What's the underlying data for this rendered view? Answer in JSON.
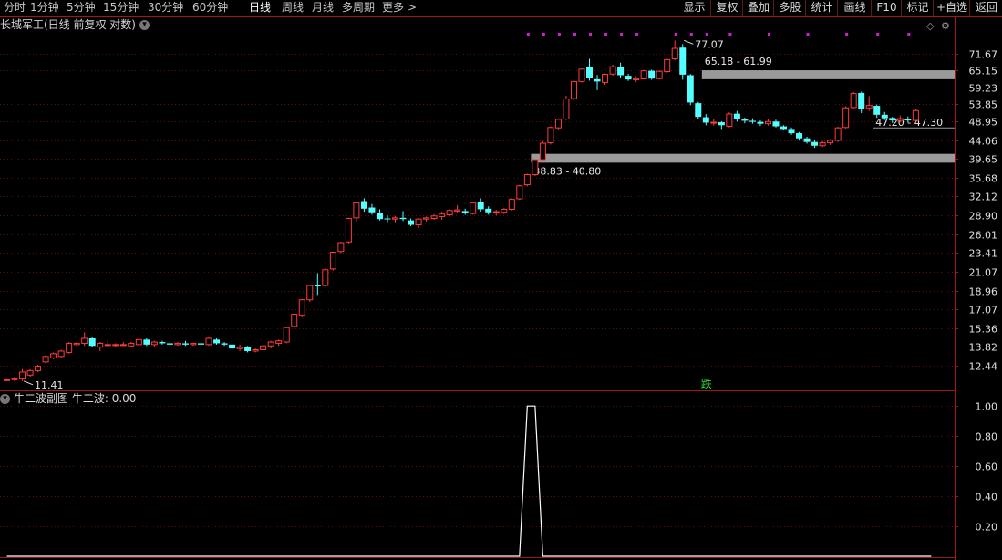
{
  "toolbar": {
    "periods": [
      "分时",
      "1分钟",
      "5分钟",
      "15分钟",
      "30分钟",
      "60分钟",
      "日线",
      "周线",
      "月线",
      "多周期",
      "更多"
    ],
    "more_arrow": ">",
    "active_period": "日线",
    "right_buttons": [
      "显示",
      "复权",
      "叠加",
      "多股",
      "统计",
      "画线",
      "F10",
      "标记",
      "+自选",
      "返回"
    ]
  },
  "main_chart": {
    "title": "长城军工(日线 前复权 对数)",
    "y_ticks": [
      "71.67",
      "65.15",
      "59.23",
      "53.85",
      "48.95",
      "44.06",
      "39.65",
      "35.68",
      "32.12",
      "28.90",
      "26.01",
      "23.41",
      "21.07",
      "18.96",
      "17.07",
      "15.36",
      "13.82",
      "12.44"
    ],
    "low_label": "11.41",
    "high_label": "77.07",
    "zones": [
      {
        "label": "65.18 - 61.99",
        "low": 61.99,
        "high": 65.18
      },
      {
        "label": "38.83 - 40.80",
        "low": 38.83,
        "high": 40.8
      },
      {
        "label": "47.20 - 47.30",
        "low": 47.2,
        "high": 47.3
      }
    ],
    "signal_label": "跌",
    "colors": {
      "up": "#ff3b3b",
      "down": "#54ffff",
      "grid": "#5a1010",
      "axis": "#a01818",
      "marker": "#d020d0",
      "zone": "#9a9a9a"
    }
  },
  "indicator": {
    "title": "牛二波副图",
    "value_label": "牛二波: 0.00",
    "y_ticks": [
      "1.00",
      "0.80",
      "0.60",
      "0.40",
      "0.20"
    ]
  },
  "chart_data": {
    "type": "candlestick",
    "scale": "log",
    "series_name": "长城军工",
    "ylim": [
      11.0,
      80.0
    ],
    "candles": [
      [
        11.5,
        11.6,
        11.4,
        11.5
      ],
      [
        11.5,
        11.7,
        11.4,
        11.6
      ],
      [
        11.6,
        12.2,
        11.41,
        12.0
      ],
      [
        11.8,
        12.2,
        11.7,
        12.1
      ],
      [
        12.1,
        12.5,
        12.0,
        12.4
      ],
      [
        12.7,
        13.2,
        12.6,
        13.1
      ],
      [
        13.0,
        13.4,
        12.9,
        13.3
      ],
      [
        13.1,
        13.6,
        13.0,
        13.5
      ],
      [
        13.4,
        14.2,
        13.3,
        14.1
      ],
      [
        14.0,
        14.2,
        13.9,
        14.1
      ],
      [
        14.1,
        15.0,
        13.9,
        14.5
      ],
      [
        14.5,
        14.6,
        13.8,
        13.9
      ],
      [
        13.8,
        14.2,
        13.5,
        14.1
      ],
      [
        14.0,
        14.3,
        13.8,
        14.0
      ],
      [
        14.0,
        14.1,
        13.8,
        14.0
      ],
      [
        14.0,
        14.2,
        13.9,
        14.0
      ],
      [
        13.9,
        14.2,
        13.8,
        14.1
      ],
      [
        14.0,
        14.5,
        13.9,
        14.4
      ],
      [
        14.4,
        14.5,
        13.9,
        14.0
      ],
      [
        14.0,
        14.3,
        13.8,
        14.2
      ],
      [
        14.2,
        14.3,
        14.0,
        14.1
      ],
      [
        14.1,
        14.2,
        13.9,
        14.0
      ],
      [
        14.0,
        14.2,
        13.9,
        14.1
      ],
      [
        14.1,
        14.3,
        13.9,
        14.0
      ],
      [
        14.0,
        14.1,
        13.9,
        14.1
      ],
      [
        14.1,
        14.2,
        13.9,
        14.0
      ],
      [
        14.0,
        14.6,
        13.9,
        14.5
      ],
      [
        14.4,
        14.5,
        14.0,
        14.1
      ],
      [
        14.1,
        14.2,
        13.9,
        14.0
      ],
      [
        14.0,
        14.1,
        13.6,
        13.7
      ],
      [
        13.7,
        14.0,
        13.5,
        13.8
      ],
      [
        13.8,
        13.9,
        13.4,
        13.5
      ],
      [
        13.5,
        13.7,
        13.4,
        13.6
      ],
      [
        13.6,
        14.0,
        13.5,
        13.9
      ],
      [
        13.9,
        14.3,
        13.7,
        14.2
      ],
      [
        14.1,
        14.4,
        13.9,
        14.3
      ],
      [
        14.2,
        15.5,
        14.1,
        15.4
      ],
      [
        15.5,
        16.7,
        15.3,
        16.6
      ],
      [
        16.5,
        18.1,
        16.3,
        18.0
      ],
      [
        18.0,
        19.6,
        17.8,
        19.5
      ],
      [
        19.5,
        20.9,
        18.5,
        19.4
      ],
      [
        19.5,
        21.5,
        19.3,
        21.3
      ],
      [
        21.4,
        23.6,
        21.2,
        23.5
      ],
      [
        23.6,
        24.9,
        23.4,
        24.8
      ],
      [
        24.9,
        28.5,
        24.7,
        28.4
      ],
      [
        28.5,
        31.2,
        27.9,
        31.0
      ],
      [
        31.3,
        31.8,
        29.5,
        30.0
      ],
      [
        30.2,
        30.8,
        29.0,
        29.4
      ],
      [
        29.3,
        29.9,
        28.1,
        28.3
      ],
      [
        28.4,
        28.9,
        27.8,
        28.3
      ],
      [
        28.3,
        28.8,
        27.8,
        28.5
      ],
      [
        28.5,
        29.6,
        28.0,
        28.3
      ],
      [
        28.1,
        28.4,
        27.2,
        27.4
      ],
      [
        27.4,
        28.5,
        26.9,
        28.3
      ],
      [
        28.3,
        28.7,
        27.9,
        28.5
      ],
      [
        28.4,
        29.1,
        28.2,
        28.8
      ],
      [
        28.7,
        29.5,
        28.2,
        29.1
      ],
      [
        29.0,
        29.9,
        28.7,
        29.7
      ],
      [
        29.6,
        30.6,
        29.3,
        29.8
      ],
      [
        29.6,
        30.0,
        29.0,
        29.3
      ],
      [
        29.2,
        31.2,
        29.0,
        31.0
      ],
      [
        31.2,
        31.8,
        29.5,
        29.9
      ],
      [
        30.0,
        30.4,
        29.0,
        29.4
      ],
      [
        29.4,
        29.8,
        28.9,
        29.5
      ],
      [
        29.4,
        30.1,
        29.1,
        29.9
      ],
      [
        29.9,
        31.8,
        29.7,
        31.6
      ],
      [
        31.7,
        34.3,
        31.5,
        34.1
      ],
      [
        34.3,
        36.5,
        34.0,
        36.3
      ],
      [
        36.3,
        39.6,
        36.0,
        39.5
      ],
      [
        39.5,
        43.8,
        39.2,
        43.3
      ],
      [
        43.4,
        47.6,
        43.0,
        47.3
      ],
      [
        47.2,
        49.8,
        46.8,
        49.5
      ],
      [
        49.6,
        56.5,
        49.3,
        55.5
      ],
      [
        55.6,
        61.4,
        55.2,
        61.2
      ],
      [
        61.2,
        65.8,
        60.9,
        65.6
      ],
      [
        66.5,
        69.5,
        61.5,
        62.3
      ],
      [
        62.0,
        63.5,
        58.3,
        61.2
      ],
      [
        60.9,
        64.0,
        60.1,
        63.7
      ],
      [
        63.8,
        67.2,
        63.2,
        66.5
      ],
      [
        66.4,
        68.0,
        62.5,
        63.4
      ],
      [
        63.2,
        63.9,
        61.4,
        61.9
      ],
      [
        61.8,
        63.0,
        61.0,
        62.2
      ],
      [
        62.1,
        65.3,
        61.9,
        65.0
      ],
      [
        65.0,
        65.4,
        61.8,
        62.2
      ],
      [
        62.2,
        65.1,
        61.9,
        64.8
      ],
      [
        64.7,
        69.5,
        64.3,
        69.2
      ],
      [
        69.5,
        77.07,
        68.9,
        73.7
      ],
      [
        74.0,
        75.5,
        61.8,
        63.6
      ],
      [
        63.4,
        63.8,
        53.6,
        54.4
      ],
      [
        54.2,
        54.6,
        49.6,
        50.2
      ],
      [
        50.1,
        51.0,
        47.9,
        48.6
      ],
      [
        48.6,
        49.5,
        47.8,
        48.7
      ],
      [
        48.7,
        49.0,
        46.9,
        47.9
      ],
      [
        47.6,
        51.5,
        47.3,
        51.0
      ],
      [
        51.1,
        51.9,
        48.9,
        49.5
      ],
      [
        49.5,
        50.0,
        48.4,
        49.1
      ],
      [
        49.1,
        49.8,
        48.3,
        48.8
      ],
      [
        48.8,
        49.2,
        47.7,
        48.3
      ],
      [
        48.3,
        49.6,
        47.8,
        48.9
      ],
      [
        48.9,
        49.4,
        47.3,
        47.6
      ],
      [
        47.6,
        47.9,
        46.6,
        46.9
      ],
      [
        46.9,
        47.3,
        45.4,
        45.8
      ],
      [
        45.8,
        46.1,
        44.2,
        44.5
      ],
      [
        44.5,
        44.9,
        43.2,
        43.6
      ],
      [
        43.6,
        44.0,
        42.2,
        42.7
      ],
      [
        42.7,
        43.9,
        42.4,
        43.4
      ],
      [
        43.4,
        44.3,
        42.9,
        44.0
      ],
      [
        44.0,
        47.5,
        43.6,
        47.2
      ],
      [
        47.3,
        53.3,
        47.0,
        52.8
      ],
      [
        52.9,
        57.7,
        52.4,
        57.2
      ],
      [
        57.4,
        57.8,
        51.3,
        52.6
      ],
      [
        52.8,
        56.4,
        51.9,
        53.5
      ],
      [
        53.4,
        53.8,
        49.9,
        50.8
      ],
      [
        50.8,
        51.6,
        49.3,
        49.8
      ],
      [
        49.9,
        50.2,
        48.5,
        49.2
      ],
      [
        49.2,
        50.6,
        48.7,
        49.7
      ],
      [
        49.6,
        50.3,
        48.6,
        49.2
      ],
      [
        49.2,
        52.4,
        48.9,
        52.0
      ]
    ],
    "indicator_series_name": "牛二波",
    "indicator_ylim": [
      0,
      1.05
    ],
    "indicator_values": [
      0,
      0,
      0,
      0,
      0,
      0,
      0,
      0,
      0,
      0,
      0,
      0,
      0,
      0,
      0,
      0,
      0,
      0,
      0,
      0,
      0,
      0,
      0,
      0,
      0,
      0,
      0,
      0,
      0,
      0,
      0,
      0,
      0,
      0,
      0,
      0,
      0,
      0,
      0,
      0,
      0,
      0,
      0,
      0,
      0,
      0,
      0,
      0,
      0,
      0,
      0,
      0,
      0,
      0,
      0,
      0,
      0,
      0,
      0,
      0,
      0,
      0,
      0,
      0,
      0,
      0,
      0,
      1,
      1,
      0,
      0,
      0,
      0,
      0,
      0,
      0,
      0,
      0,
      0,
      0,
      0,
      0,
      0,
      0,
      0,
      0,
      0,
      0,
      0,
      0,
      0,
      0,
      0,
      0,
      0,
      0,
      0,
      0,
      0,
      0,
      0,
      0,
      0,
      0,
      0,
      0,
      0,
      0,
      0,
      0,
      0,
      0,
      0,
      0,
      0,
      0,
      0,
      0,
      0,
      0
    ]
  }
}
